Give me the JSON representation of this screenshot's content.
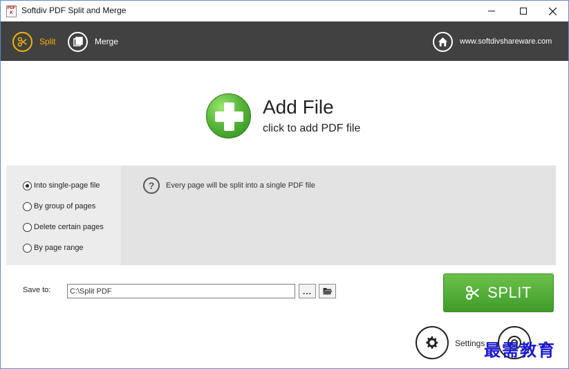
{
  "window": {
    "title": "Softdiv PDF Split and Merge",
    "icon_text": "PDF K"
  },
  "nav": {
    "split_label": "Split",
    "merge_label": "Merge",
    "website_label": "www.softdivshareware.com",
    "active_color": "#f4b400"
  },
  "add_file": {
    "title": "Add File",
    "subtitle": "click to add PDF file"
  },
  "options": {
    "items": [
      {
        "label": "Into single-page file",
        "checked": true
      },
      {
        "label": "By group of pages",
        "checked": false
      },
      {
        "label": "Delete certain pages",
        "checked": false
      },
      {
        "label": "By page range",
        "checked": false
      }
    ],
    "description": "Every page will be split into a single PDF file"
  },
  "save": {
    "label": "Save to:",
    "path": "C:\\Split PDF",
    "browse_label": "...",
    "folder_icon": "folder-open-icon"
  },
  "split_button": {
    "label": "SPLIT",
    "color": "#4fa934"
  },
  "bottom": {
    "settings_label": "Settings",
    "help_label": "...p",
    "watermark": "最需教育"
  }
}
